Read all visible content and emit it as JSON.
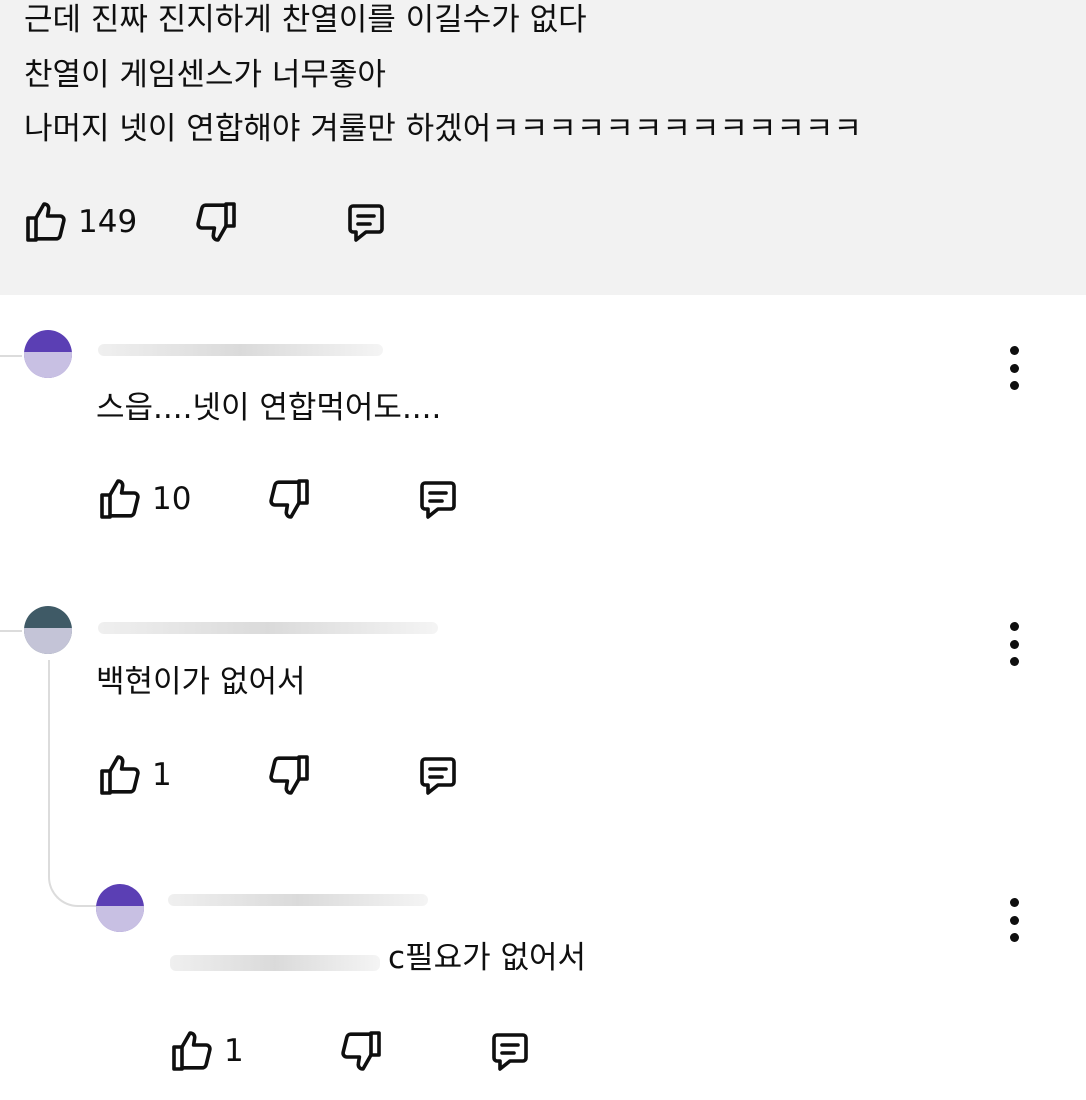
{
  "parent_comment": {
    "lines": [
      "근데 진짜 진지하게 찬열이를 이길수가 없다",
      " 찬열이 게임센스가 너무좋아",
      "나머지 넷이 연합해야 겨룰만 하겠어ㅋㅋㅋㅋㅋㅋㅋㅋㅋㅋㅋㅋㅋ"
    ],
    "like_count": "149"
  },
  "replies": [
    {
      "text": "스읍....넷이 연합먹어도....",
      "like_count": "10",
      "avatar_color": "#5b3fb4"
    },
    {
      "text": "백현이가 없어서",
      "like_count": "1",
      "avatar_color": "#3f5a66"
    },
    {
      "text": "c필요가 없어서",
      "like_count": "1",
      "avatar_color": "#5b3fb4"
    }
  ],
  "icons": {
    "like": "thumbs-up-icon",
    "dislike": "thumbs-down-icon",
    "reply": "comment-icon",
    "more": "more-vertical-icon"
  }
}
